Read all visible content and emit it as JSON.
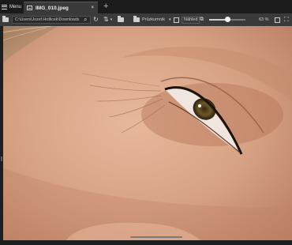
{
  "menu": {
    "label": "Menu",
    "icon": "hamburger-icon"
  },
  "tab": {
    "title": "IMG_010.jpeg",
    "close": "×",
    "add": "+"
  },
  "toolbar": {
    "path": "C:\\Users\\Jozef.Hrdlicek\\Downloads",
    "explorer_label": "Průzkumník",
    "preview_label": "Náhled",
    "zoom_text": "63 %",
    "zoom_fraction": 0.5
  },
  "viewer": {
    "image_description_icon": "photo-image",
    "colors": {
      "skin": "#d7a284",
      "background": "#3a3a3a"
    }
  }
}
